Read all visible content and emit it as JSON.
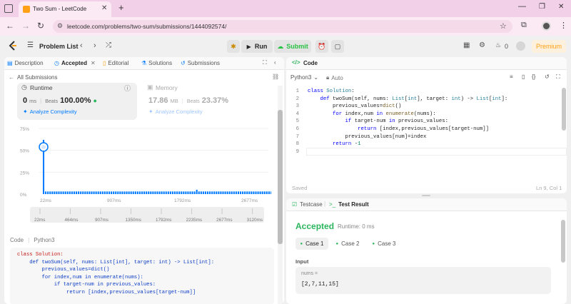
{
  "browser": {
    "tab_title": "Two Sum - LeetCode",
    "url": "leetcode.com/problems/two-sum/submissions/1444092574/"
  },
  "navbar": {
    "problem_list": "Problem List",
    "run": "Run",
    "submit": "Submit",
    "streak": "0",
    "premium": "Premium"
  },
  "left": {
    "tabs": [
      "Description",
      "Accepted",
      "Editorial",
      "Solutions",
      "Submissions"
    ],
    "all_submissions": "All Submissions",
    "runtime": {
      "label": "Runtime",
      "value": "0",
      "unit": "ms",
      "beats_label": "Beats",
      "beats_value": "100.00%",
      "analyze": "Analyze Complexity"
    },
    "memory": {
      "label": "Memory",
      "value": "17.86",
      "unit": "MB",
      "beats_label": "Beats",
      "beats_value": "23.37%",
      "analyze": "Analyze Complexity"
    },
    "code_label": "Code",
    "code_lang": "Python3",
    "code_preview": [
      "class Solution:",
      "    def twoSum(self, nums: List[int], target: int) -> List[int]:",
      "        previous_values=dict()",
      "        for index,num in enumerate(nums):",
      "            if target-num in previous_values:",
      "                return [index,previous_values[target-num]]"
    ]
  },
  "chart_data": {
    "type": "bar",
    "y_ticks": [
      "75%",
      "50%",
      "25%",
      "0%"
    ],
    "x_ticks": [
      "22ms",
      "907ms",
      "1792ms",
      "2677ms"
    ],
    "range_ticks": [
      "22ms",
      "464ms",
      "907ms",
      "1350ms",
      "1792ms",
      "2235ms",
      "2677ms",
      "3120ms"
    ],
    "ylim": [
      0,
      75
    ],
    "values": [
      62,
      3,
      3,
      3,
      3,
      3,
      3,
      3,
      3,
      3,
      3,
      3,
      3,
      3,
      3,
      3,
      3,
      3,
      3,
      3,
      3,
      3,
      3,
      3,
      3,
      3,
      3,
      3,
      3,
      3,
      3,
      3,
      3,
      3,
      3,
      3,
      3,
      3,
      3,
      3,
      3,
      3,
      3,
      3,
      3,
      3,
      3,
      3,
      3,
      3,
      3,
      3,
      3,
      3,
      3,
      3,
      3,
      3,
      3,
      3,
      3,
      3,
      3,
      3,
      3,
      3,
      3,
      3,
      3,
      3,
      5,
      3,
      3,
      3,
      3,
      3,
      3,
      3,
      3,
      3,
      3,
      3,
      3,
      3,
      3,
      3,
      3,
      3,
      3,
      3,
      3,
      3,
      3,
      3,
      3,
      3,
      3,
      3,
      3,
      3,
      3,
      3,
      3,
      3,
      3
    ],
    "highlight_index": 0
  },
  "code": {
    "title": "Code",
    "language": "Python3",
    "mode": "Auto",
    "lines": [
      "class Solution:",
      "    def twoSum(self, nums: List[int], target: int) -> List[int]:",
      "        previous_values=dict()",
      "        for index,num in enumerate(nums):",
      "            if target-num in previous_values:",
      "                return [index,previous_values[target-num]]",
      "            previous_values[num]=index",
      "        return -1",
      ""
    ],
    "status": "Saved",
    "cursor": "Ln 9, Col 1"
  },
  "test": {
    "tabs": [
      "Testcase",
      "Test Result"
    ],
    "result": "Accepted",
    "runtime": "Runtime: 0 ms",
    "cases": [
      "Case 1",
      "Case 2",
      "Case 3"
    ],
    "input_label": "Input",
    "var_name": "nums =",
    "var_value": "[2,7,11,15]"
  },
  "colors": {
    "accent": "#2db55d",
    "accepted": "#2db55d",
    "submit": "#28c244",
    "premium": "#ffa116",
    "link": "#007aff"
  }
}
